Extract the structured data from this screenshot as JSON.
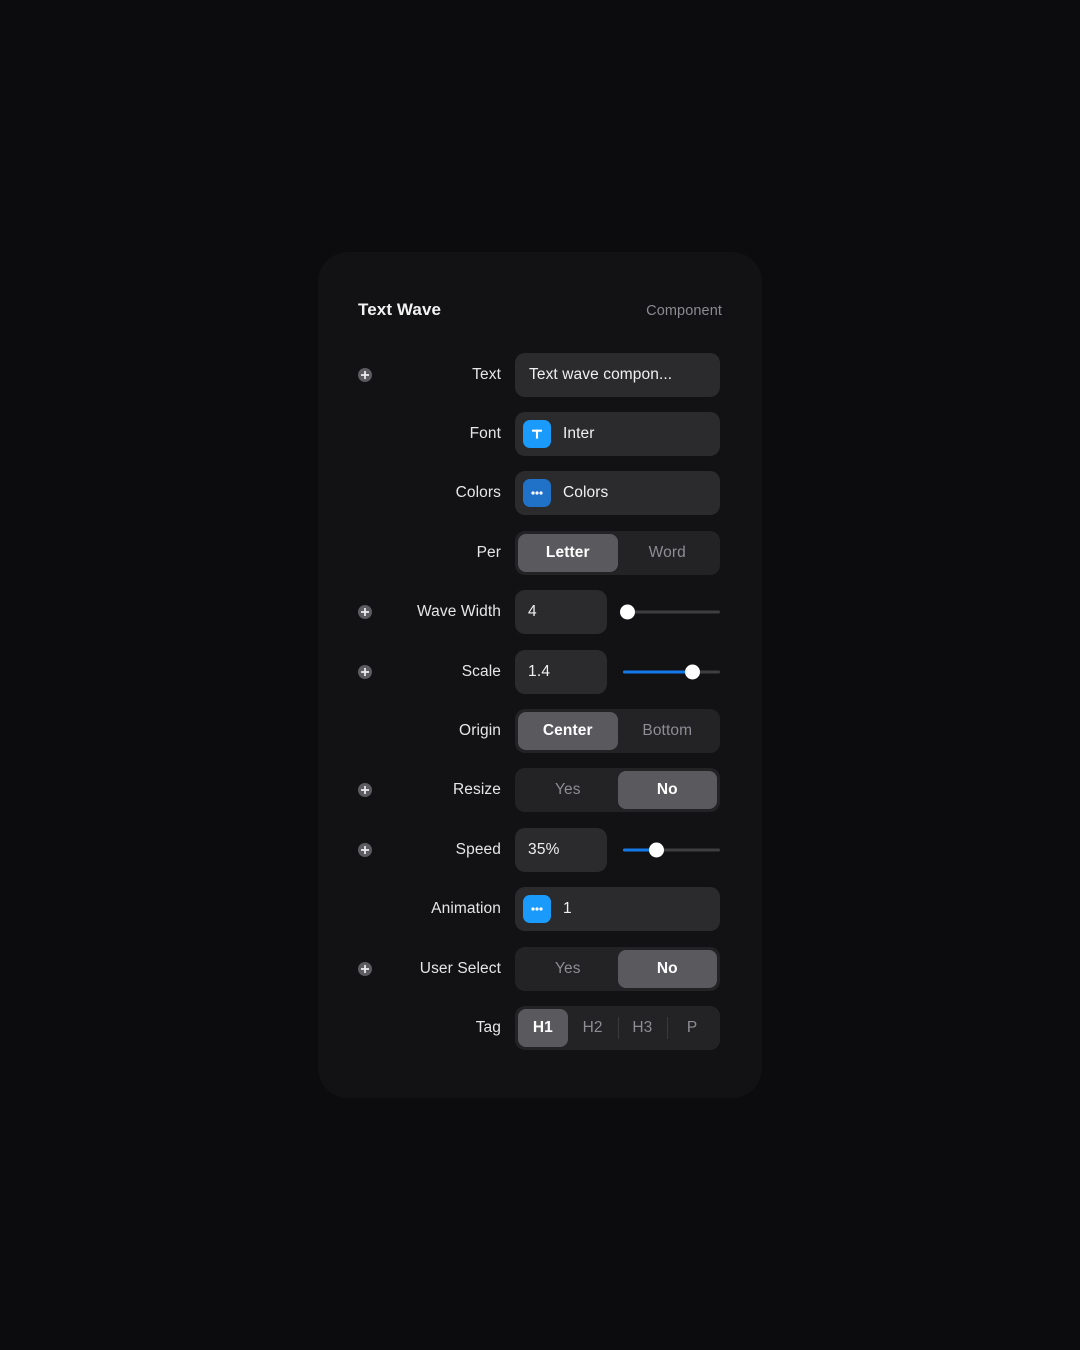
{
  "panel": {
    "title": "Text Wave",
    "kind": "Component"
  },
  "rows": {
    "text": {
      "label": "Text",
      "value": "Text wave compon...",
      "has_plus": true
    },
    "font": {
      "label": "Font",
      "value": "Inter",
      "icon": "text-format-icon",
      "icon_color": "#1a9bfc",
      "has_plus": false
    },
    "colors": {
      "label": "Colors",
      "value": "Colors",
      "icon": "more-dots-icon",
      "icon_color": "#2072c8",
      "has_plus": false
    },
    "per": {
      "label": "Per",
      "options": [
        "Letter",
        "Word"
      ],
      "selected": "Letter",
      "has_plus": false
    },
    "wave_width": {
      "label": "Wave Width",
      "value": "4",
      "slider_percent": 5,
      "slider_filled": false,
      "has_plus": true
    },
    "scale": {
      "label": "Scale",
      "value": "1.4",
      "slider_percent": 72,
      "slider_filled": true,
      "has_plus": true
    },
    "origin": {
      "label": "Origin",
      "options": [
        "Center",
        "Bottom"
      ],
      "selected": "Center",
      "has_plus": false
    },
    "resize": {
      "label": "Resize",
      "options": [
        "Yes",
        "No"
      ],
      "selected": "No",
      "has_plus": true
    },
    "speed": {
      "label": "Speed",
      "value": "35%",
      "slider_percent": 35,
      "slider_filled": true,
      "has_plus": true
    },
    "animation": {
      "label": "Animation",
      "value": "1",
      "icon": "more-dots-icon",
      "icon_color": "#1a9bfc",
      "has_plus": false
    },
    "user_select": {
      "label": "User Select",
      "options": [
        "Yes",
        "No"
      ],
      "selected": "No",
      "has_plus": true
    },
    "tag": {
      "label": "Tag",
      "options": [
        "H1",
        "H2",
        "H3",
        "P"
      ],
      "selected": "H1",
      "has_plus": false
    }
  },
  "colors": {
    "background": "#0c0c0e",
    "panel": "#121214",
    "field": "#2b2b2d",
    "segment_track": "#232325",
    "segment_active": "#5a5a5e",
    "accent_blue": "#1478e8",
    "icon_blue": "#1a9bfc"
  }
}
